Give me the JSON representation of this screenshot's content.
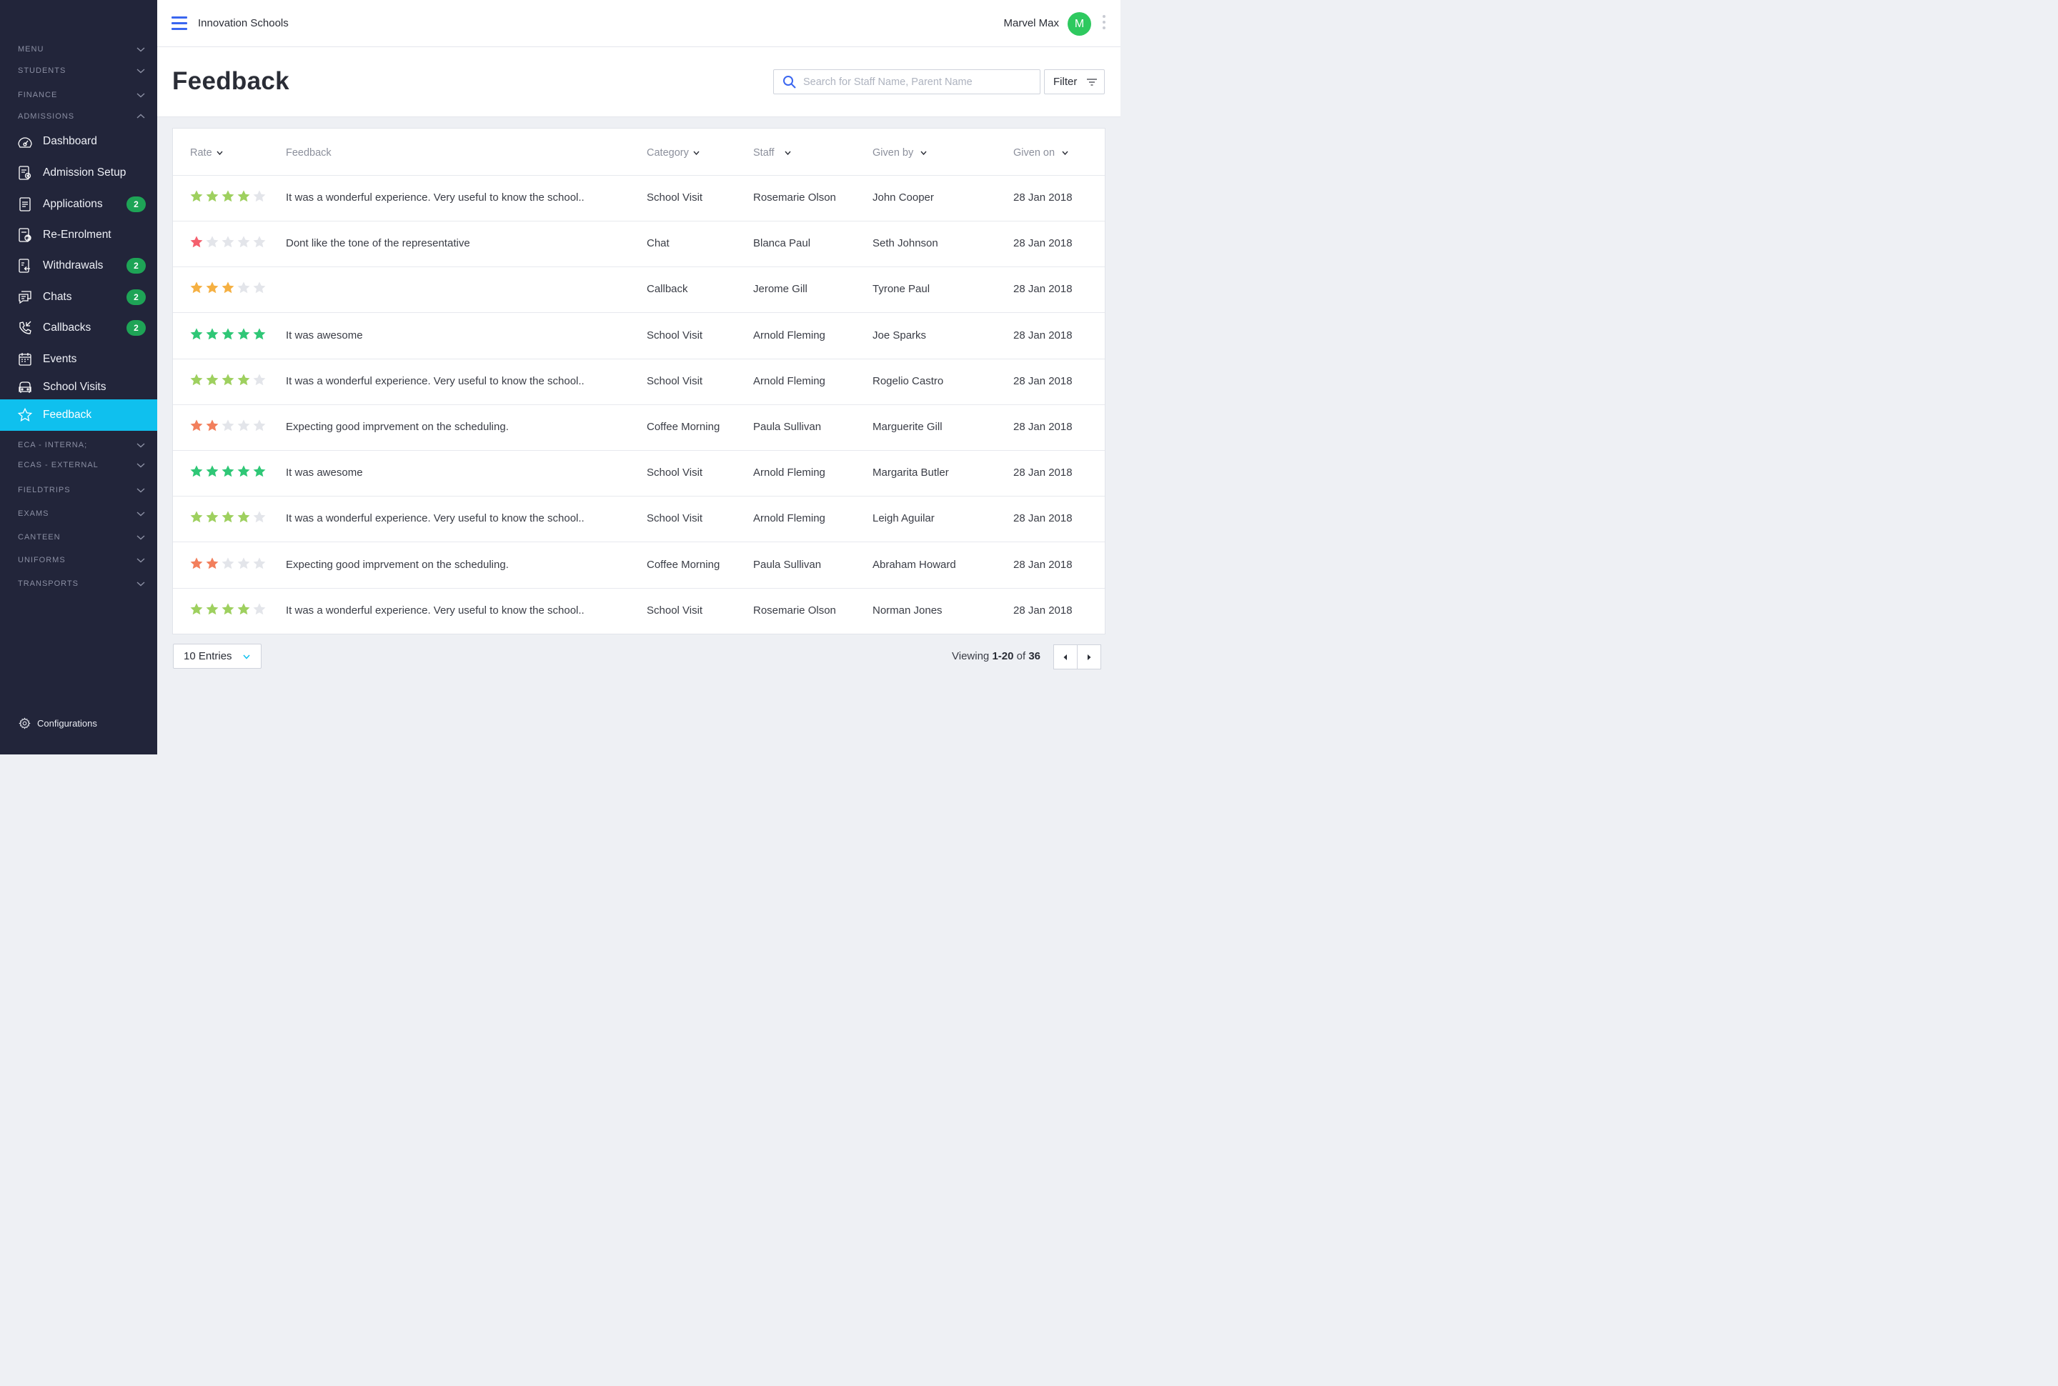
{
  "app": {
    "school_name": "Innovation Schools",
    "user_name": "Marvel Max",
    "avatar_initial": "M"
  },
  "sidebar": {
    "sections_top": [
      {
        "label": "MENU",
        "state": "collapsed"
      },
      {
        "label": "STUDENTS",
        "state": "collapsed"
      },
      {
        "label": "FINANCE",
        "state": "collapsed"
      },
      {
        "label": "ADMISSIONS",
        "state": "expanded"
      }
    ],
    "items": [
      {
        "label": "Dashboard",
        "icon": "dashboard-icon",
        "badge": ""
      },
      {
        "label": "Admission Setup",
        "icon": "admission-setup-icon",
        "badge": ""
      },
      {
        "label": "Applications",
        "icon": "applications-icon",
        "badge": "2"
      },
      {
        "label": "Re-Enrolment",
        "icon": "re-enrolment-icon",
        "badge": ""
      },
      {
        "label": "Withdrawals",
        "icon": "withdrawals-icon",
        "badge": "2"
      },
      {
        "label": "Chats",
        "icon": "chats-icon",
        "badge": "2"
      },
      {
        "label": "Callbacks",
        "icon": "callbacks-icon",
        "badge": "2"
      },
      {
        "label": "Events",
        "icon": "events-icon",
        "badge": ""
      },
      {
        "label": "School Visits",
        "icon": "school-visits-icon",
        "badge": ""
      },
      {
        "label": "Feedback",
        "icon": "feedback-star-icon",
        "badge": "",
        "active": true
      }
    ],
    "sections_bottom": [
      {
        "label": "ECA - INTERNA;"
      },
      {
        "label": "ECAS - EXTERNAL"
      },
      {
        "label": "FIELDTRIPS"
      },
      {
        "label": "EXAMS"
      },
      {
        "label": "CANTEEN"
      },
      {
        "label": "UNIFORMS"
      },
      {
        "label": "TRANSPORTS"
      }
    ],
    "configurations_label": "Configurations"
  },
  "page": {
    "title": "Feedback",
    "search_placeholder": "Search for Staff Name, Parent Name",
    "filter_label": "Filter"
  },
  "table": {
    "columns": {
      "rate": "Rate",
      "feedback": "Feedback",
      "category": "Category",
      "staff": "Staff",
      "given_by": "Given by",
      "given_on": "Given on"
    },
    "rows": [
      {
        "rating": 4,
        "feedback": "It was a wonderful experience. Very useful to know the school..",
        "category": "School Visit",
        "staff": "Rosemarie Olson",
        "given_by": "John Cooper",
        "given_on": "28 Jan 2018"
      },
      {
        "rating": 1,
        "feedback": "Dont like the tone of the representative",
        "category": "Chat",
        "staff": "Blanca Paul",
        "given_by": "Seth Johnson",
        "given_on": "28 Jan 2018"
      },
      {
        "rating": 3,
        "feedback": "",
        "category": "Callback",
        "staff": "Jerome Gill",
        "given_by": "Tyrone Paul",
        "given_on": "28 Jan 2018"
      },
      {
        "rating": 5,
        "feedback": "It was awesome",
        "category": "School Visit",
        "staff": "Arnold Fleming",
        "given_by": "Joe Sparks",
        "given_on": "28 Jan 2018"
      },
      {
        "rating": 4,
        "feedback": "It was a wonderful experience. Very useful to know the school..",
        "category": "School Visit",
        "staff": "Arnold Fleming",
        "given_by": "Rogelio Castro",
        "given_on": "28 Jan 2018"
      },
      {
        "rating": 2,
        "feedback": "Expecting good imprvement on the scheduling.",
        "category": "Coffee Morning",
        "staff": "Paula Sullivan",
        "given_by": "Marguerite Gill",
        "given_on": "28 Jan 2018"
      },
      {
        "rating": 5,
        "feedback": "It was awesome",
        "category": "School Visit",
        "staff": "Arnold Fleming",
        "given_by": "Margarita Butler",
        "given_on": "28 Jan 2018"
      },
      {
        "rating": 4,
        "feedback": "It was a wonderful experience. Very useful to know the school..",
        "category": "School Visit",
        "staff": "Arnold Fleming",
        "given_by": "Leigh Aguilar",
        "given_on": "28 Jan 2018"
      },
      {
        "rating": 2,
        "feedback": "Expecting good imprvement on the scheduling.",
        "category": "Coffee Morning",
        "staff": "Paula Sullivan",
        "given_by": "Abraham Howard",
        "given_on": "28 Jan 2018"
      },
      {
        "rating": 4,
        "feedback": "It was a wonderful experience. Very useful to know the school..",
        "category": "School Visit",
        "staff": "Rosemarie Olson",
        "given_by": "Norman Jones",
        "given_on": "28 Jan 2018"
      }
    ]
  },
  "rating_colors": {
    "1": "#f4606e",
    "2": "#f27f5c",
    "3": "#f5b042",
    "4": "#9ed05f",
    "5": "#2fc776",
    "empty": "#e3e5ea"
  },
  "footer": {
    "entries_label": "10 Entries",
    "viewing_prefix": "Viewing",
    "viewing_range": "1-20",
    "viewing_of": "of",
    "viewing_total": "36"
  },
  "colors": {
    "sidebar_bg": "#22253a",
    "active": "#0fc0ee",
    "badge": "#1ea456",
    "accent": "#3a66f0",
    "avatar": "#2ec95f"
  }
}
